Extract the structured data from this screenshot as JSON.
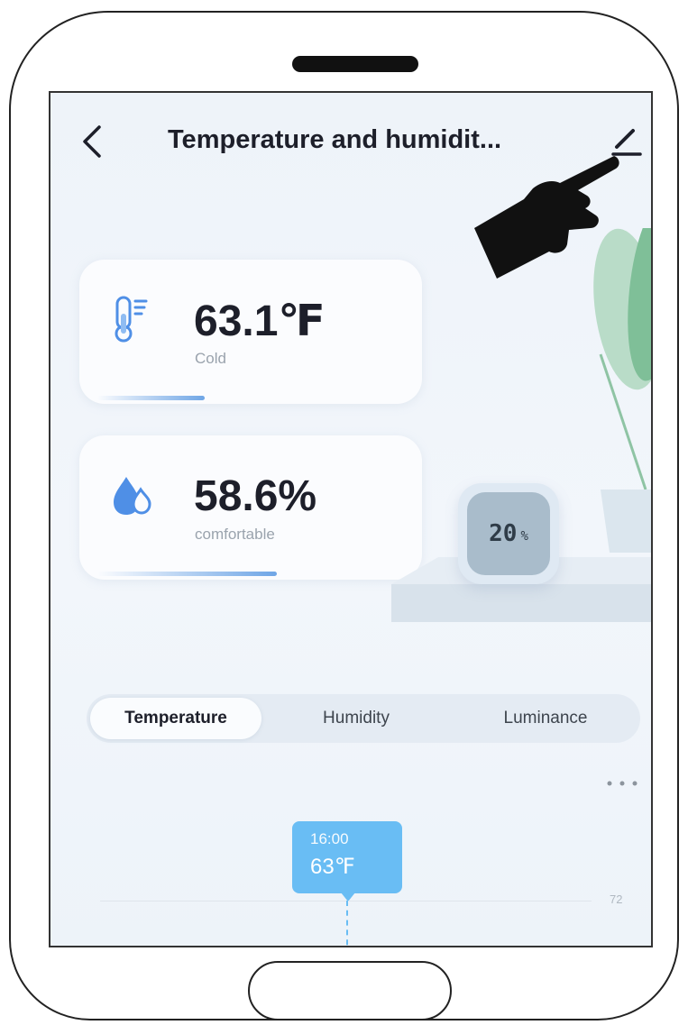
{
  "header": {
    "title": "Temperature and humidit...",
    "back_icon": "chevron-left-icon",
    "edit_icon": "pencil-icon"
  },
  "temperature_card": {
    "value": "63.1℉",
    "status": "Cold",
    "icon": "thermometer-icon",
    "level": 0.35
  },
  "humidity_card": {
    "value": "58.6%",
    "status": "comfortable",
    "icon": "water-drop-icon",
    "level": 0.586
  },
  "device_display": {
    "value": "20",
    "unit": "%"
  },
  "tabs": [
    {
      "label": "Temperature",
      "active": true
    },
    {
      "label": "Humidity",
      "active": false
    },
    {
      "label": "Luminance",
      "active": false
    }
  ],
  "chart": {
    "tooltip_time": "16:00",
    "tooltip_value": "63℉",
    "y_tick": "72",
    "more_icon": "more-horizontal-icon"
  },
  "colors": {
    "accent": "#69bdf4",
    "progress": "#6fa6e6",
    "background": "#eef3f9"
  }
}
